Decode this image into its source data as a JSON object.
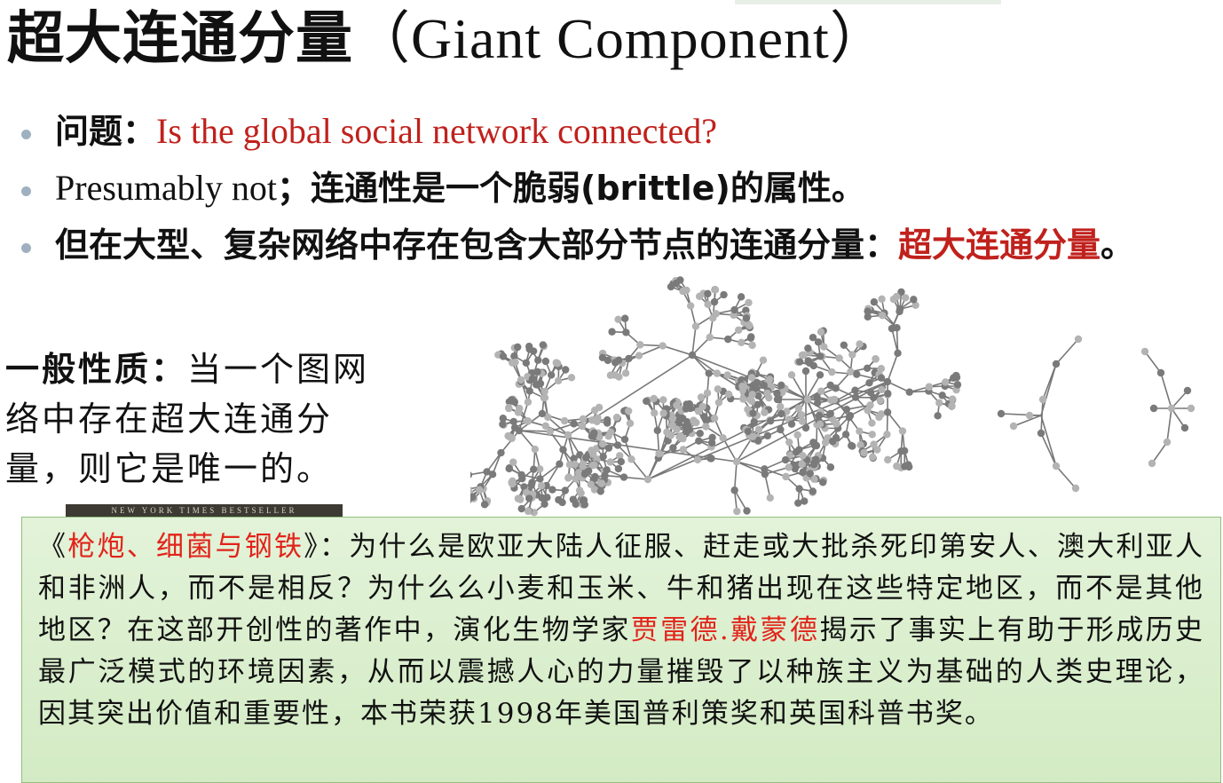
{
  "slide": {
    "title_zh": "超大连通分量",
    "title_en": "（Giant Component）",
    "bullets": [
      {
        "prefix": "问题：",
        "text_red": "Is the global social network connected?"
      },
      {
        "lead": "Presumably not",
        "rest": "；连通性是一个脆弱(brittle)的属性。"
      },
      {
        "text": "但在大型、复杂网络中存在包含大部分节点的连通分量：",
        "text_red": "超大连通分量",
        "end": "。"
      }
    ],
    "general": {
      "label": "一般性质：",
      "text": "当一个图网络中存在超大连通分量，则它是唯一的。"
    },
    "book_banner": "NEW YORK TIMES BESTSELLER",
    "book_box": {
      "open": "《",
      "book_title": "枪炮、细菌与钢铁",
      "close_and_text": "》：为什么是欧亚大陆人征服、赶走或大批杀死印第安人、澳大利亚人和非洲人，而不是相反？为什么么小麦和玉米、牛和猪出现在这些特定地区，而不是其他地区？在这部开创性的著作中，演化生物学家",
      "author": "贾雷德.戴蒙德",
      "rest": "揭示了事实上有助于形成历史最广泛模式的环境因素，从而以震撼人心的力量摧毁了以种族主义为基础的人类史理论，因其突出价值和重要性，本书荣获1998年美国普利策奖和英国科普书奖。"
    }
  }
}
